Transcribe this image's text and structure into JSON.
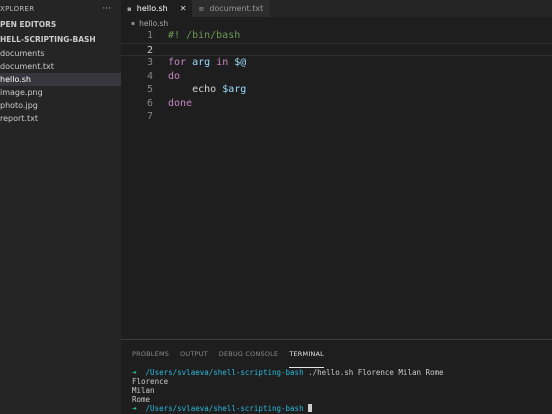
{
  "sidebar": {
    "header": "XPLORER",
    "more": "···",
    "open_editors": "PEN EDITORS",
    "folder": "HELL-SCRIPTING-BASH",
    "items": [
      "documents",
      "document.txt",
      "hello.sh",
      "image.png",
      "photo.jpg",
      "report.txt"
    ],
    "active_index": 2
  },
  "tabs": [
    {
      "label": "hello.sh",
      "active": true,
      "icon": "terminal-file-icon"
    },
    {
      "label": "document.txt",
      "active": false,
      "icon": "text-file-icon"
    }
  ],
  "breadcrumb": "hello.sh",
  "editor": {
    "lines": [
      {
        "n": "1",
        "text": "#! /bin/bash"
      },
      {
        "n": "2",
        "text": ""
      },
      {
        "n": "3",
        "kw": "for",
        "var": "arg",
        "kw2": "in",
        "var2": "$@"
      },
      {
        "n": "4",
        "text": "do"
      },
      {
        "n": "5",
        "cmd": "echo",
        "var": "$arg"
      },
      {
        "n": "6",
        "text": "done"
      },
      {
        "n": "7",
        "text": ""
      }
    ],
    "current_line": 2
  },
  "panel": {
    "tabs": [
      "PROBLEMS",
      "OUTPUT",
      "DEBUG CONSOLE",
      "TERMINAL"
    ],
    "active_tab": "TERMINAL"
  },
  "terminal": {
    "arrow": "➜",
    "path": "/Users/svlaeva/shell-scripting-bash",
    "command": "./hello.sh Florence Milan Rome",
    "output": [
      "Florence",
      "Milan",
      "Rome"
    ]
  },
  "colors": {
    "background": "#1e1e1e",
    "sidebar": "#252526",
    "keyword": "#c586c0",
    "variable": "#9cdcfe",
    "comment": "#6a9955",
    "prompt_arrow": "#23d18b",
    "prompt_path": "#29b8db"
  }
}
